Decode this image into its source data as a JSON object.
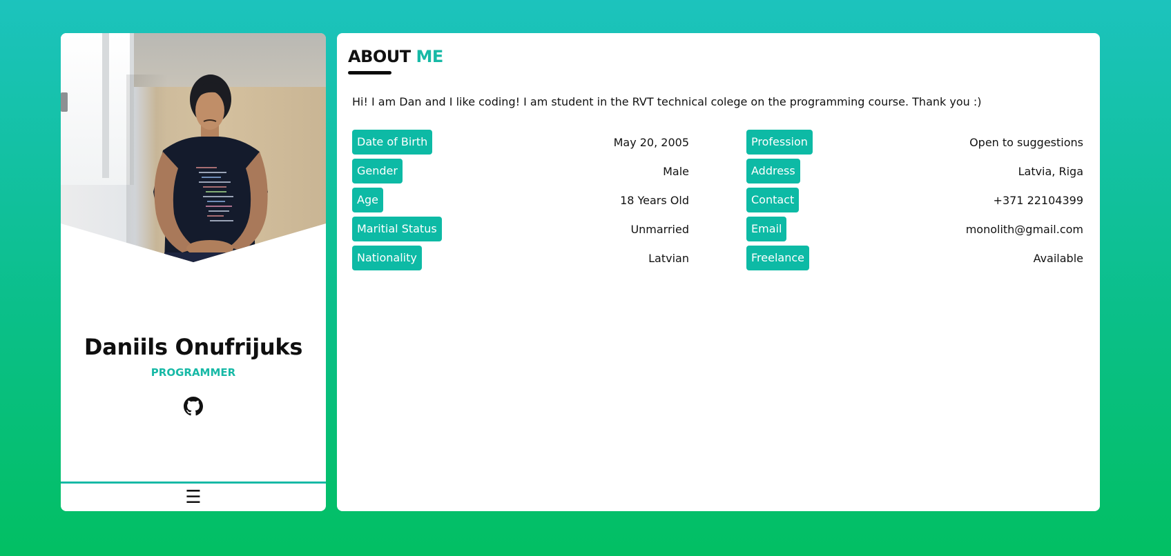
{
  "profile": {
    "name": "Daniils Onufrijuks",
    "role": "PROGRAMMER",
    "social_icon": "github-icon",
    "menu_icon": "☰"
  },
  "about": {
    "title_main": "ABOUT",
    "title_accent": "ME",
    "bio": "Hi! I am Dan and I like coding! I am student in the RVT technical colege on the programming course. Thank you :)",
    "left": [
      {
        "label": "Date of Birth",
        "value": "May 20, 2005"
      },
      {
        "label": "Gender",
        "value": "Male"
      },
      {
        "label": "Age",
        "value": "18 Years Old"
      },
      {
        "label": "Maritial Status",
        "value": "Unmarried"
      },
      {
        "label": "Nationality",
        "value": "Latvian"
      }
    ],
    "right": [
      {
        "label": "Profession",
        "value": "Open to suggestions"
      },
      {
        "label": "Address",
        "value": "Latvia, Riga"
      },
      {
        "label": "Contact",
        "value": "+371 22104399"
      },
      {
        "label": "Email",
        "value": "monolith@gmail.com"
      },
      {
        "label": "Freelance",
        "value": "Available"
      }
    ]
  },
  "colors": {
    "accent": "#17b9a6",
    "label_bg": "#0dbaa5",
    "bg_top": "#1cc3bd",
    "bg_bottom": "#02bf63"
  }
}
